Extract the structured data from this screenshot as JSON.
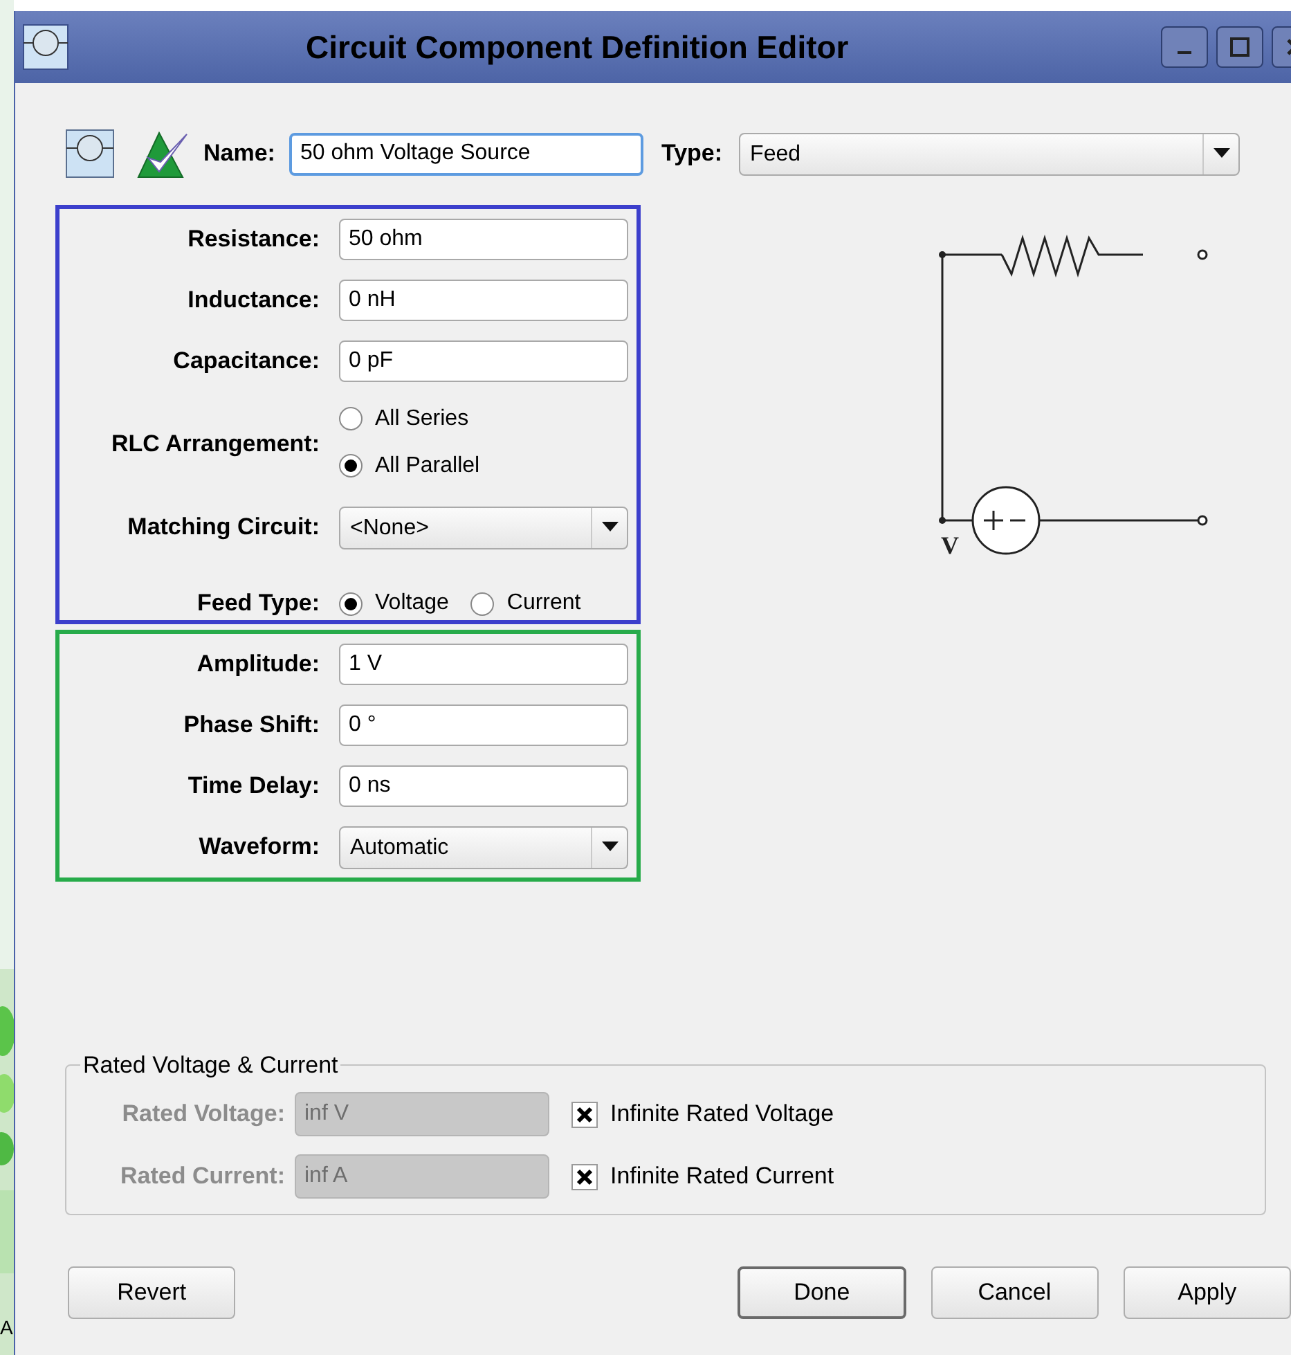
{
  "window": {
    "title": "Circuit Component Definition Editor"
  },
  "header": {
    "name_label": "Name:",
    "name_value": "50 ohm Voltage Source",
    "type_label": "Type:",
    "type_value": "Feed"
  },
  "rlc_group": [
    {
      "kind": "text",
      "label": "Resistance:",
      "value": "50 ohm"
    },
    {
      "kind": "text",
      "label": "Inductance:",
      "value": "0 nH"
    },
    {
      "kind": "text",
      "label": "Capacitance:",
      "value": "0 pF"
    },
    {
      "kind": "radio",
      "label": "RLC Arrangement:",
      "options": [
        {
          "label": "All Series",
          "selected": false
        },
        {
          "label": "All Parallel",
          "selected": true
        }
      ]
    },
    {
      "kind": "dropdown",
      "label": "Matching Circuit:",
      "value": "<None>"
    },
    {
      "kind": "radio_inline",
      "label": "Feed Type:",
      "options": [
        {
          "label": "Voltage",
          "selected": true
        },
        {
          "label": "Current",
          "selected": false
        }
      ]
    }
  ],
  "source_group": [
    {
      "kind": "text",
      "label": "Amplitude:",
      "value": "1 V"
    },
    {
      "kind": "text",
      "label": "Phase Shift:",
      "value": "0 °"
    },
    {
      "kind": "text",
      "label": "Time Delay:",
      "value": "0 ns"
    },
    {
      "kind": "dropdown",
      "label": "Waveform:",
      "value": "Automatic"
    }
  ],
  "circuit": {
    "node_label": "V"
  },
  "rated": {
    "title": "Rated Voltage & Current",
    "rows": [
      {
        "label": "Rated Voltage:",
        "value": "inf V",
        "disabled": true,
        "checkbox_label": "Infinite Rated Voltage",
        "checked": true
      },
      {
        "label": "Rated Current:",
        "value": "inf A",
        "disabled": true,
        "checkbox_label": "Infinite Rated Current",
        "checked": true
      }
    ]
  },
  "buttons": [
    {
      "label": "Revert",
      "default": false
    },
    {
      "label": "Done",
      "default": true
    },
    {
      "label": "Cancel",
      "default": false
    },
    {
      "label": "Apply",
      "default": false
    }
  ],
  "background_text": "A"
}
